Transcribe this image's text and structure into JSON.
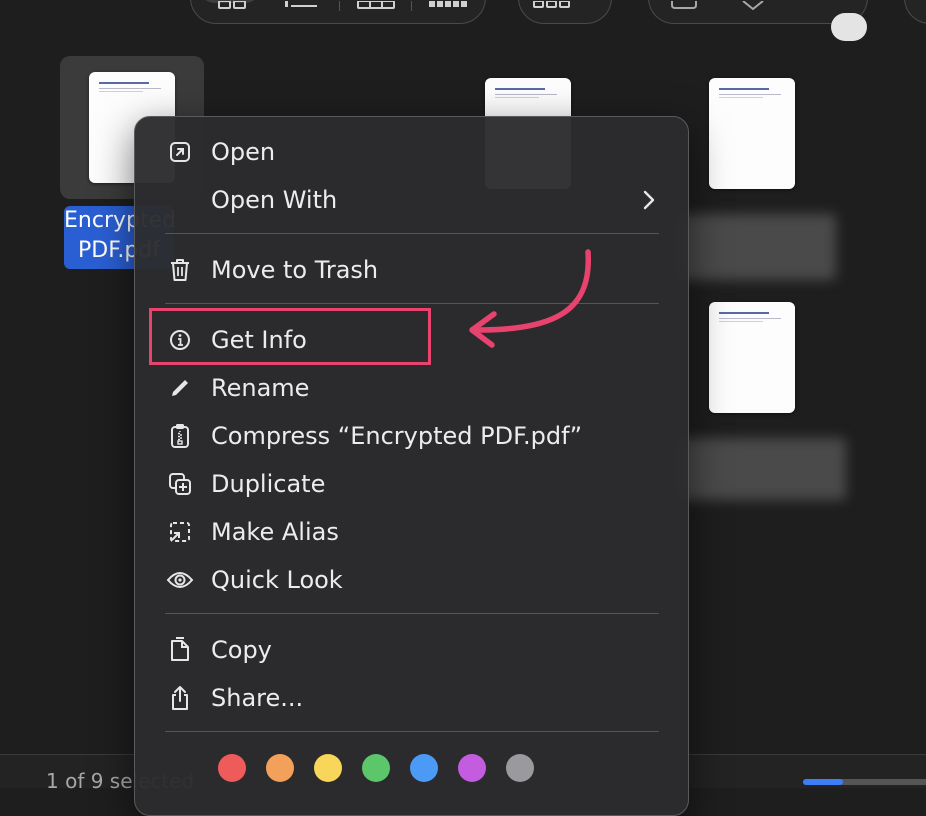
{
  "finder": {
    "selected_file_name": "Encrypted PDF.pdf",
    "status_text": "1 of 9 selected"
  },
  "context_menu": {
    "groups": [
      [
        {
          "label": "Open",
          "icon": "open-arrow-icon"
        },
        {
          "label": "Open With",
          "icon": "",
          "submenu": true
        }
      ],
      [
        {
          "label": "Move to Trash",
          "icon": "trash-icon"
        }
      ],
      [
        {
          "label": "Get Info",
          "icon": "info-icon",
          "highlighted": true
        },
        {
          "label": "Rename",
          "icon": "pencil-icon"
        },
        {
          "label": "Compress “Encrypted PDF.pdf”",
          "icon": "archive-icon"
        },
        {
          "label": "Duplicate",
          "icon": "duplicate-icon"
        },
        {
          "label": "Make Alias",
          "icon": "alias-icon"
        },
        {
          "label": "Quick Look",
          "icon": "eye-icon"
        }
      ],
      [
        {
          "label": "Copy",
          "icon": "copy-icon"
        },
        {
          "label": "Share...",
          "icon": "share-icon"
        }
      ]
    ],
    "tag_colors": [
      "#ef5b5b",
      "#f2a05a",
      "#f7d65a",
      "#5cc66a",
      "#4b9af5",
      "#c45ce0",
      "#9a9a9e"
    ]
  },
  "annotation": {
    "color": "#e8436f",
    "target": "Get Info"
  },
  "colors": {
    "selection_blue": "#2a5fd4",
    "slider_blue": "#3d7ef7"
  }
}
